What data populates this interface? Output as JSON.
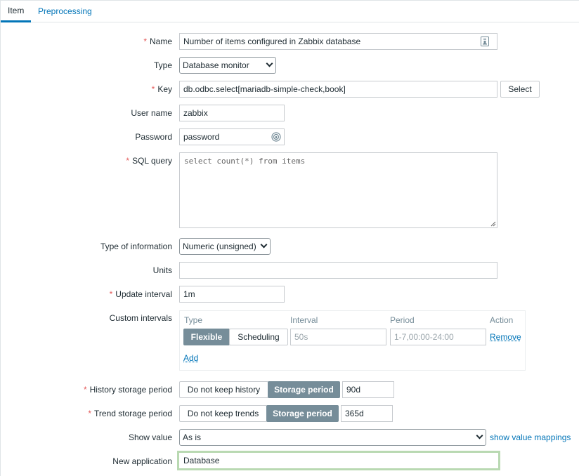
{
  "tabs": [
    {
      "label": "Item"
    },
    {
      "label": "Preprocessing"
    }
  ],
  "form": {
    "name": {
      "label": "Name",
      "value": "Number of items configured in Zabbix database",
      "required": true
    },
    "type": {
      "label": "Type",
      "value": "Database monitor"
    },
    "key": {
      "label": "Key",
      "value": "db.odbc.select[mariadb-simple-check,book]",
      "required": true,
      "select_label": "Select"
    },
    "username": {
      "label": "User name",
      "value": "zabbix"
    },
    "password": {
      "label": "Password",
      "value": "password"
    },
    "sql_query": {
      "label": "SQL query",
      "value": "select count(*) from items",
      "required": true
    },
    "type_of_information": {
      "label": "Type of information",
      "value": "Numeric (unsigned)"
    },
    "units": {
      "label": "Units",
      "value": ""
    },
    "update_interval": {
      "label": "Update interval",
      "value": "1m",
      "required": true
    },
    "custom_intervals": {
      "label": "Custom intervals",
      "headers": {
        "type": "Type",
        "interval": "Interval",
        "period": "Period",
        "action": "Action"
      },
      "row": {
        "flexible_label": "Flexible",
        "scheduling_label": "Scheduling",
        "interval_placeholder": "50s",
        "period_placeholder": "1-7,00:00-24:00",
        "remove_label": "Remove"
      },
      "add_label": "Add"
    },
    "history": {
      "label": "History storage period",
      "required": true,
      "option_off": "Do not keep history",
      "option_on": "Storage period",
      "value": "90d"
    },
    "trend": {
      "label": "Trend storage period",
      "required": true,
      "option_off": "Do not keep trends",
      "option_on": "Storage period",
      "value": "365d"
    },
    "show_value": {
      "label": "Show value",
      "value": "As is",
      "mappings_link": "show value mappings"
    },
    "new_application": {
      "label": "New application",
      "value": "Database"
    }
  },
  "colors": {
    "link": "#0275b8",
    "required": "#e45959",
    "active_toggle": "#768d99",
    "focus_border": "#b9d9b2"
  },
  "icons": {
    "name_field": "macro-list-icon",
    "password_field": "lock-icon"
  }
}
